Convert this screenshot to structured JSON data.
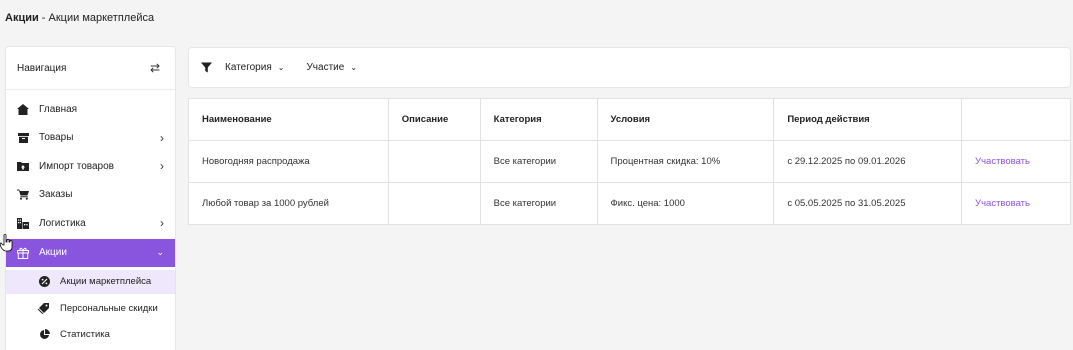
{
  "header": {
    "title_bold": "Акции",
    "title_rest": " - Акции маркетплейса"
  },
  "sidebar": {
    "heading": "Навигация",
    "items": [
      {
        "label": "Главная",
        "icon": "home-icon",
        "chevron": ""
      },
      {
        "label": "Товары",
        "icon": "archive-icon",
        "chevron": "›"
      },
      {
        "label": "Импорт товаров",
        "icon": "folder-upload-icon",
        "chevron": "›"
      },
      {
        "label": "Заказы",
        "icon": "cart-icon",
        "chevron": ""
      },
      {
        "label": "Логистика",
        "icon": "warehouse-icon",
        "chevron": "›"
      },
      {
        "label": "Акции",
        "icon": "gift-icon",
        "chevron": "⌄"
      }
    ],
    "subitems": [
      {
        "label": "Акции маркетплейса",
        "icon": "percent-badge-icon"
      },
      {
        "label": "Персональные скидки",
        "icon": "tags-icon"
      },
      {
        "label": "Статистика",
        "icon": "pie-chart-icon"
      }
    ]
  },
  "filters": {
    "category": "Категория",
    "participation": "Участие"
  },
  "table": {
    "columns": [
      "Наименование",
      "Описание",
      "Категория",
      "Условия",
      "Период действия",
      ""
    ],
    "rows": [
      {
        "name": "Новогодняя распродажа",
        "description": "",
        "category": "Все категории",
        "conditions": "Процентная скидка: 10%",
        "period": "с 29.12.2025 по 09.01.2026",
        "action": "Участвовать"
      },
      {
        "name": "Любой товар за 1000 рублей",
        "description": "",
        "category": "Все категории",
        "conditions": "Фикс. цена: 1000",
        "period": "с 05.05.2025 по 31.05.2025",
        "action": "Участвовать"
      }
    ]
  },
  "colors": {
    "accent": "#8a55de",
    "accent_light": "#efe7fb",
    "background": "#f4f4f5"
  }
}
